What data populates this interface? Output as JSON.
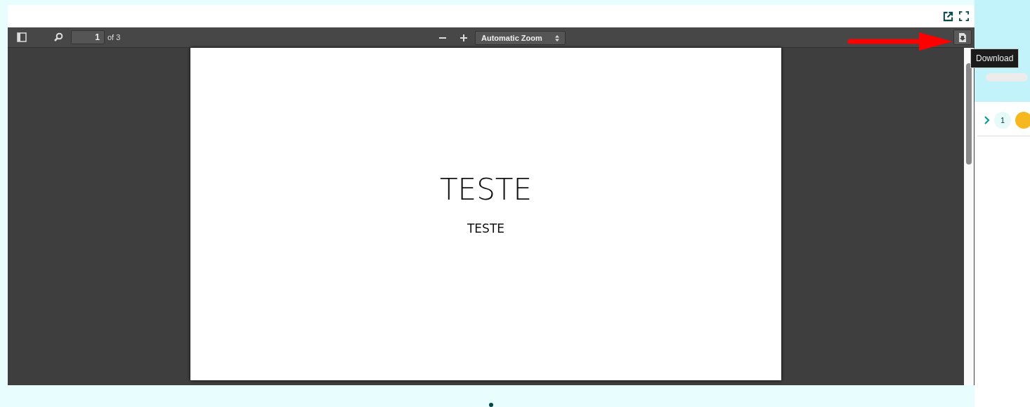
{
  "viewer": {
    "page_number": "1",
    "page_count": "of 3",
    "zoom": "Automatic Zoom",
    "tooltip": "Download"
  },
  "document": {
    "title": "TESTE",
    "subtitle": "TESTE"
  },
  "side_panel": {
    "row": {
      "expanded": false,
      "count": "1"
    }
  }
}
